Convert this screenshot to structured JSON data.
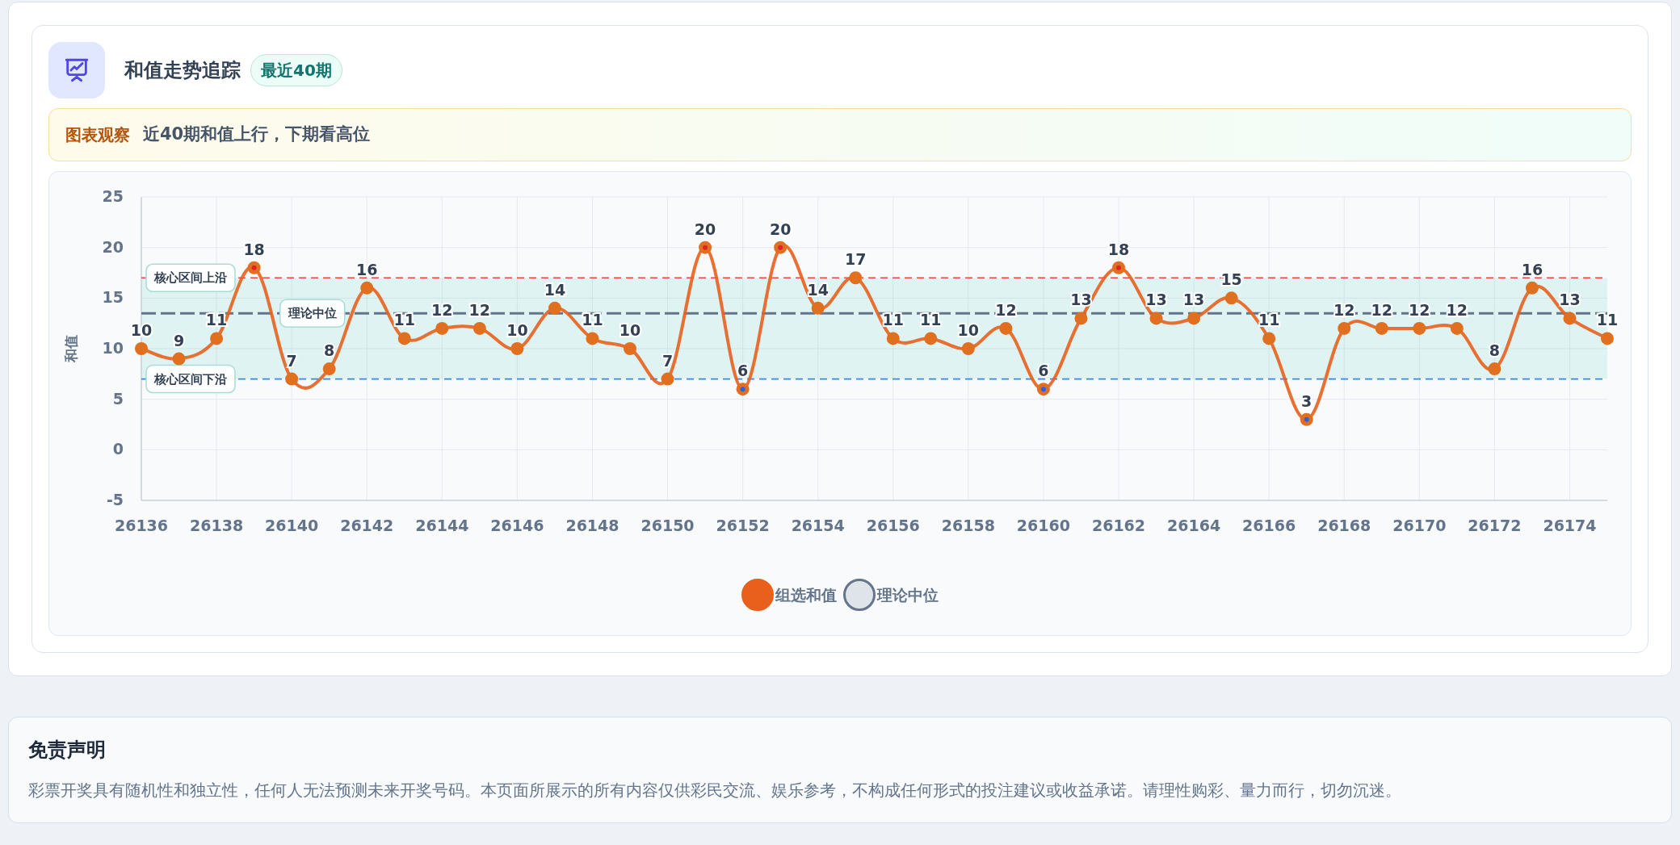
{
  "header": {
    "title": "和值走势追踪",
    "badge": "最近40期"
  },
  "insight": {
    "label": "图表观察",
    "text": "近40期和值上行，下期看高位"
  },
  "chart_data": {
    "type": "line",
    "ylabel": "和值",
    "x": [
      26136,
      26137,
      26138,
      26139,
      26140,
      26141,
      26142,
      26143,
      26144,
      26145,
      26146,
      26147,
      26148,
      26149,
      26150,
      26151,
      26152,
      26153,
      26154,
      26155,
      26156,
      26157,
      26158,
      26159,
      26160,
      26161,
      26162,
      26163,
      26164,
      26165,
      26166,
      26167,
      26168,
      26169,
      26170,
      26171,
      26172,
      26173,
      26174,
      26175
    ],
    "series": [
      {
        "name": "组选和值",
        "color": "#e8601c",
        "marker": "circle",
        "values": [
          10,
          9,
          11,
          18,
          7,
          8,
          16,
          11,
          12,
          12,
          10,
          14,
          11,
          10,
          7,
          20,
          6,
          20,
          14,
          17,
          11,
          11,
          10,
          12,
          6,
          13,
          18,
          13,
          13,
          15,
          11,
          3,
          12,
          12,
          12,
          12,
          8,
          16,
          13,
          11
        ]
      }
    ],
    "xlim": [
      26136,
      26175
    ],
    "xticks": [
      26136,
      26138,
      26140,
      26142,
      26144,
      26146,
      26148,
      26150,
      26152,
      26154,
      26156,
      26158,
      26160,
      26162,
      26164,
      26166,
      26168,
      26170,
      26172,
      26174
    ],
    "ylim": [
      -5,
      25
    ],
    "yticks": [
      -5,
      0,
      5,
      10,
      15,
      20,
      25
    ],
    "grid": true,
    "data_labels": true,
    "bands": [
      {
        "axis": "y",
        "from": 7,
        "to": 17,
        "color": "#14b8a6"
      }
    ],
    "ref_lines": [
      {
        "axis": "y",
        "value": 7,
        "label": "核心区间下沿",
        "color": "#3b82f6"
      },
      {
        "axis": "y",
        "value": 17,
        "label": "核心区间上沿",
        "color": "#ef4444"
      },
      {
        "axis": "y",
        "value": 13.5,
        "label": "理论中位",
        "color": "#64748b"
      }
    ],
    "legend": {
      "items": [
        {
          "label": "理论中位",
          "color": "#64748b"
        }
      ]
    }
  },
  "disclaimer": {
    "title": "免责声明",
    "text": "彩票开奖具有随机性和独立性，任何人无法预测未来开奖号码。本页面所展示的所有内容仅供彩民交流、娱乐参考，不构成任何形式的投注建议或收益承诺。请理性购彩、量力而行，切勿沉迷。"
  }
}
